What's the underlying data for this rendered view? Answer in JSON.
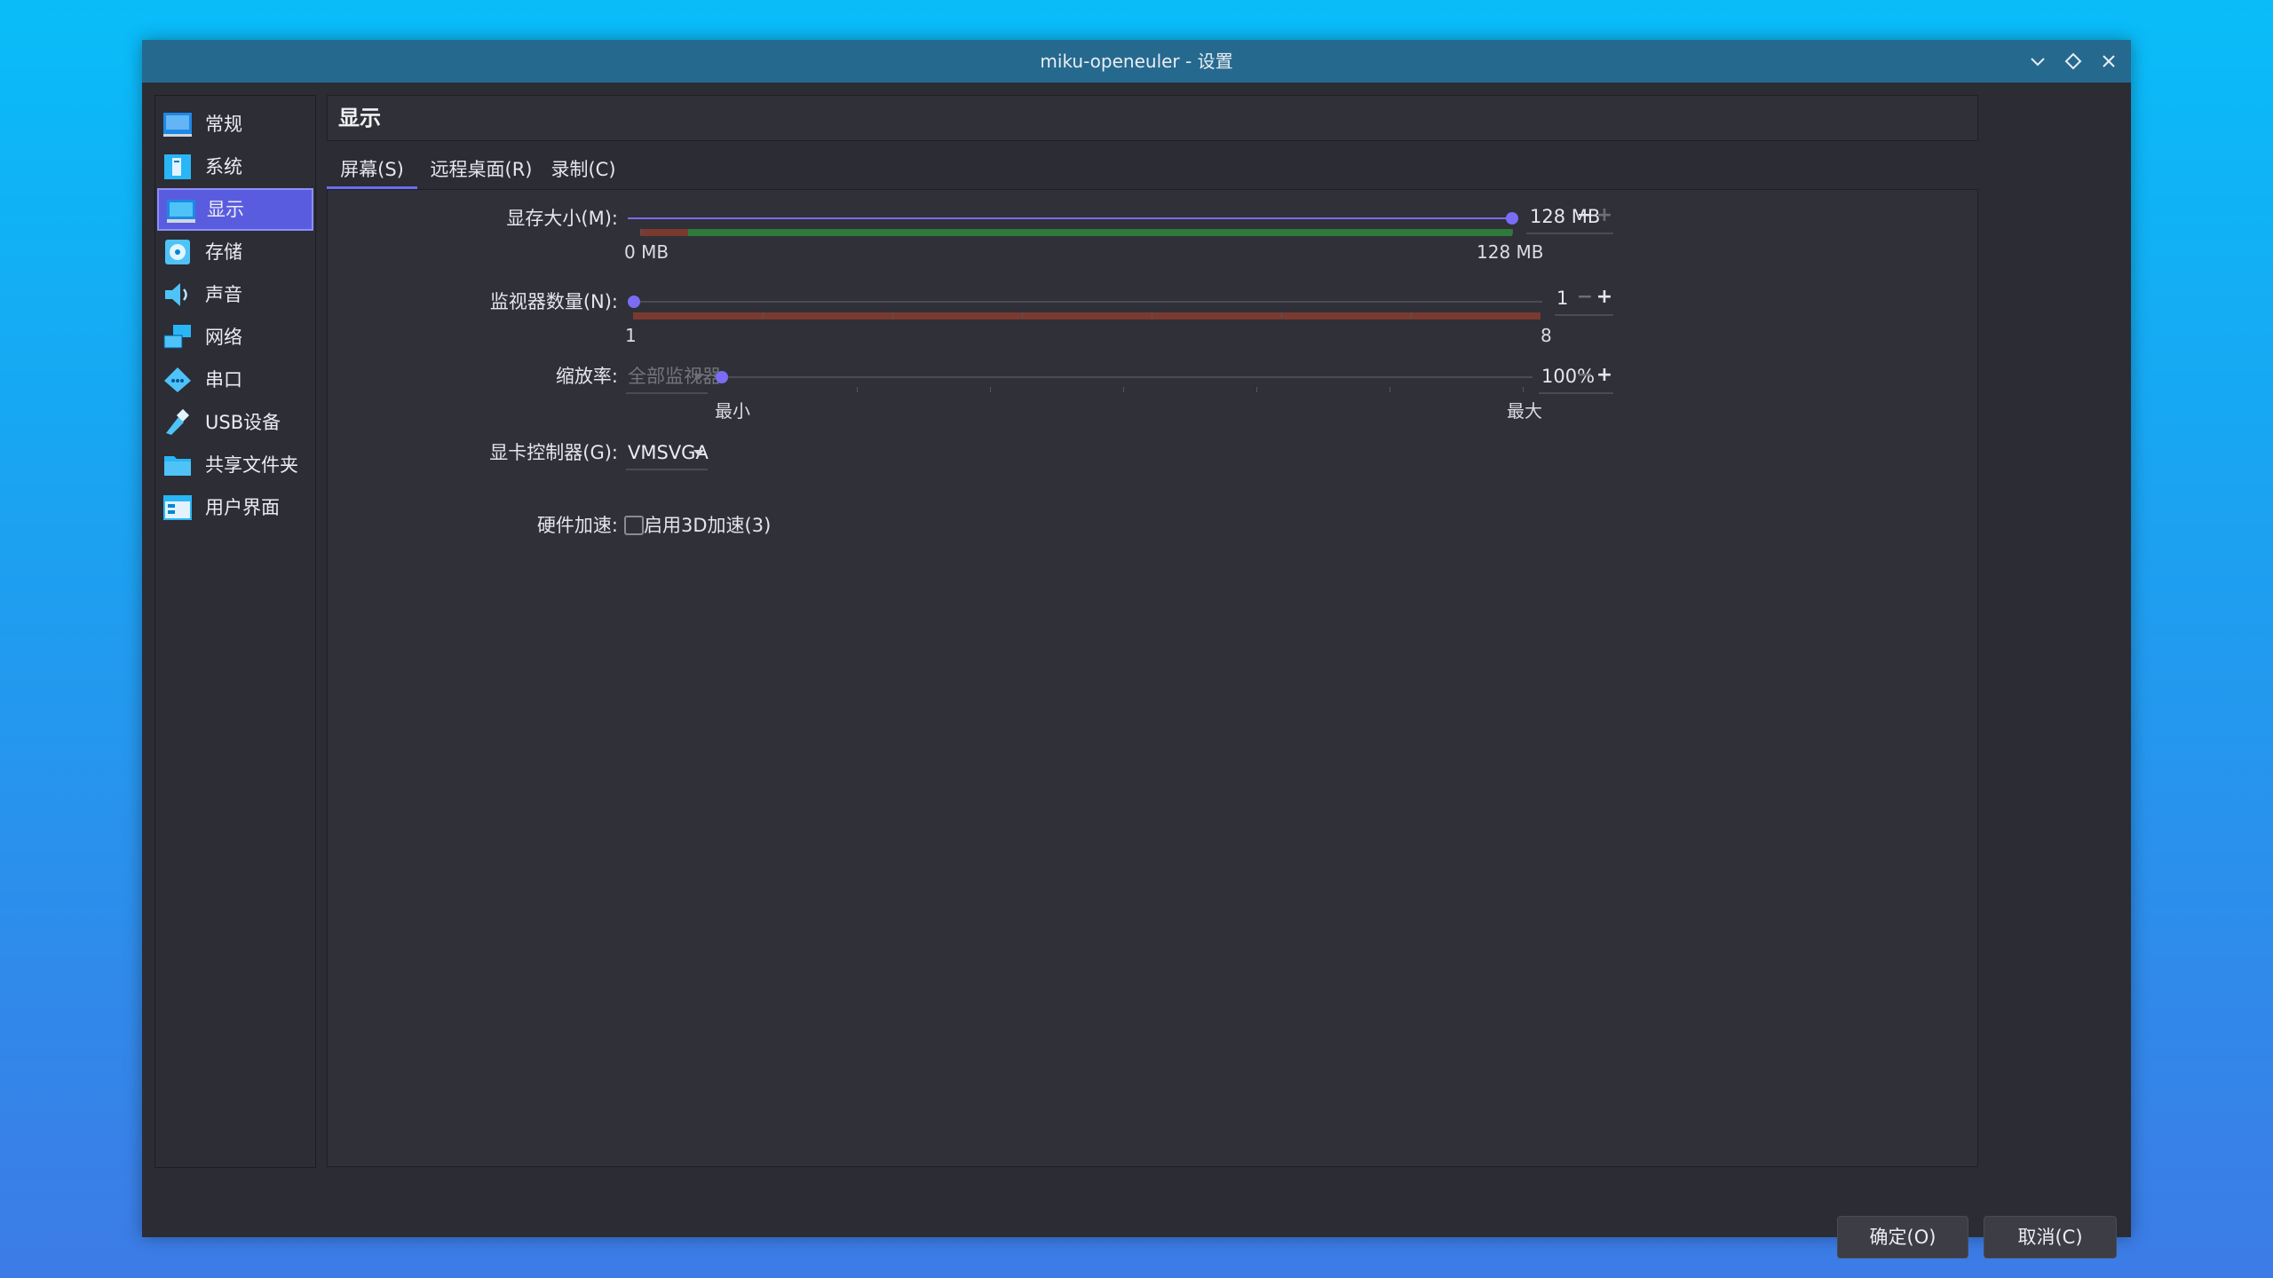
{
  "window": {
    "title": "miku-openeuler - 设置",
    "controls": [
      "chevron-down-icon",
      "diamond-icon",
      "close-icon"
    ]
  },
  "sidebar": {
    "items": [
      {
        "label": "常规",
        "icon": "general-icon"
      },
      {
        "label": "系统",
        "icon": "system-icon"
      },
      {
        "label": "显示",
        "icon": "display-icon",
        "selected": true
      },
      {
        "label": "存储",
        "icon": "storage-icon"
      },
      {
        "label": "声音",
        "icon": "audio-icon"
      },
      {
        "label": "网络",
        "icon": "network-icon"
      },
      {
        "label": "串口",
        "icon": "serial-port-icon"
      },
      {
        "label": "USB设备",
        "icon": "usb-icon"
      },
      {
        "label": "共享文件夹",
        "icon": "shared-folder-icon"
      },
      {
        "label": "用户界面",
        "icon": "user-interface-icon"
      }
    ]
  },
  "panel": {
    "title": "显示",
    "tabs": [
      {
        "label": "屏幕(S)",
        "active": true
      },
      {
        "label": "远程桌面(R)"
      },
      {
        "label": "录制(C)"
      }
    ]
  },
  "screen": {
    "video_memory": {
      "label": "显存大小(M):",
      "value": "128 MB",
      "min_label": "0 MB",
      "max_label": "128 MB",
      "level": 1.0,
      "decrement": "−",
      "increment": "+"
    },
    "monitor_count": {
      "label": "监视器数量(N):",
      "value": "1",
      "min_label": "1",
      "max_label": "8",
      "level": 0.0,
      "decrement": "−",
      "increment": "+"
    },
    "scale_factor": {
      "label": "缩放率:",
      "monitor_select": "全部监视器",
      "value": "100%",
      "min_label": "最小",
      "max_label": "最大",
      "level": 0.0,
      "decrement": "−",
      "increment": "+"
    },
    "graphics_controller": {
      "label": "显卡控制器(G):",
      "value": "VMSVGA"
    },
    "acceleration": {
      "label": "硬件加速:",
      "checkbox_label": "启用3D加速(3)",
      "checked": false
    }
  },
  "buttons": {
    "ok": "确定(O)",
    "cancel": "取消(C)"
  },
  "colors": {
    "accent": "#6a6df0",
    "selection": "#5a5ce0",
    "titlebar": "#26698f",
    "recommended": "#2d7a3a",
    "warning": "#7a3a30"
  }
}
